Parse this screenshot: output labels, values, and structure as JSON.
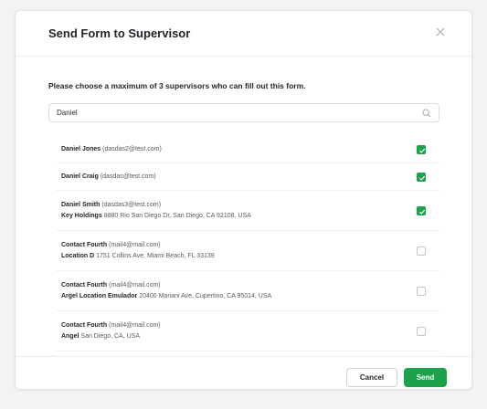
{
  "modal": {
    "title": "Send Form to Supervisor",
    "close_icon": "close-icon",
    "instruction": "Please choose a maximum of 3 supervisors who can fill out this form."
  },
  "search": {
    "value": "Daniel",
    "placeholder": "",
    "icon": "search-icon"
  },
  "supervisors": [
    {
      "name": "Daniel Jones",
      "email": "(dasdas2@test.com)",
      "location_name": "",
      "address": "",
      "checked": true
    },
    {
      "name": "Daniel Craig",
      "email": "(dasdas@test.com)",
      "location_name": "",
      "address": "",
      "checked": true
    },
    {
      "name": "Daniel Smith",
      "email": "(dasdas3@test.com)",
      "location_name": "Key Holdings",
      "address": "8880 Rio San Diego Dr, San Diego, CA 92108, USA",
      "checked": true
    },
    {
      "name": "Contact Fourth",
      "email": "(mail4@mail.com)",
      "location_name": "Location D",
      "address": "1751 Collins Ave, Miami Beach, FL 33139",
      "checked": false
    },
    {
      "name": "Contact Fourth",
      "email": "(mail4@mail.com)",
      "location_name": "Argel Location Emulador",
      "address": "20400 Mariani Ave, Cupertino, CA 95014, USA",
      "checked": false
    },
    {
      "name": "Contact Fourth",
      "email": "(mail4@mail.com)",
      "location_name": "Angel",
      "address": "San Diego, CA, USA",
      "checked": false
    }
  ],
  "footer": {
    "cancel_label": "Cancel",
    "send_label": "Send"
  },
  "colors": {
    "accent": "#1aa34a",
    "checkbox_border": "#c4c4c4",
    "text": "#1f2328",
    "muted_text": "#555b61"
  }
}
